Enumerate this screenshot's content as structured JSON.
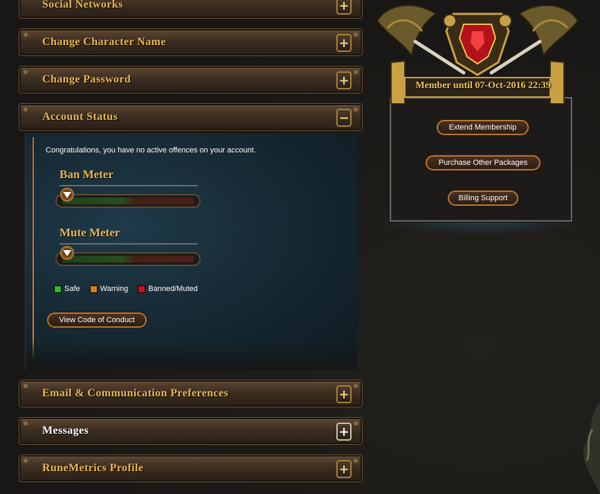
{
  "sections": [
    {
      "label": "Social Networks",
      "state": "collapsed",
      "toggle": "+"
    },
    {
      "label": "Change Character Name",
      "state": "collapsed",
      "toggle": "+"
    },
    {
      "label": "Change Password",
      "state": "collapsed",
      "toggle": "+"
    },
    {
      "label": "Account Status",
      "state": "expanded",
      "toggle": "−"
    },
    {
      "label": "Email & Communication Preferences",
      "state": "collapsed",
      "toggle": "+"
    },
    {
      "label": "Messages",
      "state": "collapsed",
      "toggle": "+"
    },
    {
      "label": "RuneMetrics Profile",
      "state": "collapsed",
      "toggle": "+"
    }
  ],
  "account_status": {
    "message": "Congratulations, you have no active offences on your account.",
    "ban_meter": {
      "title": "Ban Meter",
      "level": 0
    },
    "mute_meter": {
      "title": "Mute Meter",
      "level": 0
    },
    "legend": [
      {
        "label": "Safe",
        "color": "#2fb62a"
      },
      {
        "label": "Warning",
        "color": "#d97f19"
      },
      {
        "label": "Banned/Muted",
        "color": "#c4161c"
      }
    ],
    "conduct_button": "View Code of Conduct"
  },
  "membership": {
    "status": "Member until 07-Oct-2016 22:39",
    "buttons": [
      "Extend Membership",
      "Purchase Other Packages",
      "Billing Support"
    ]
  },
  "colors": {
    "accent_gold": "#e9b750",
    "button_border": "#b4783a",
    "panel_blue": "#1f3a4a"
  }
}
